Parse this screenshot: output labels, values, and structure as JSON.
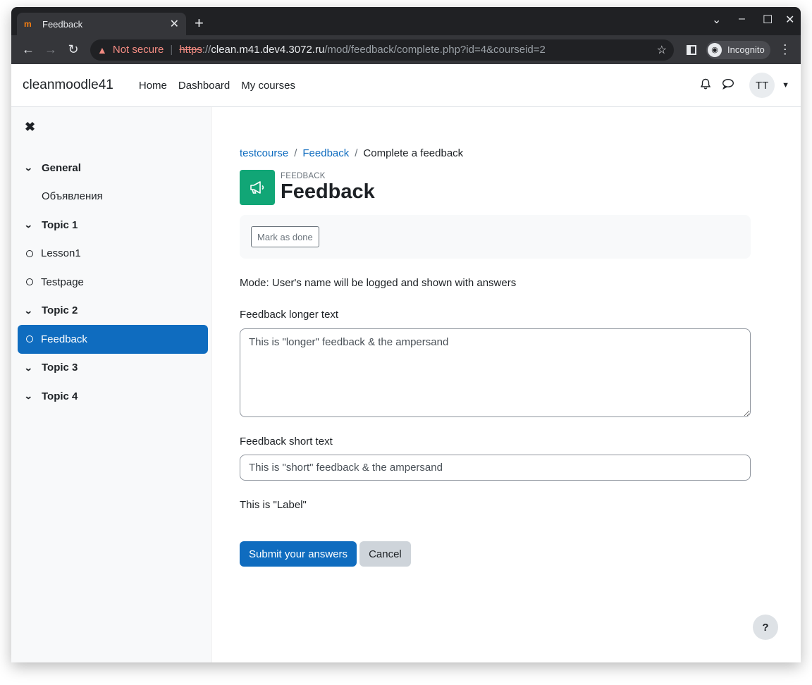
{
  "browser": {
    "tab_title": "Feedback",
    "favicon_text": "m",
    "url_warning": "Not secure",
    "url_protocol": "https",
    "url_sep": "://",
    "url_host": "clean.m41.dev4.3072.ru",
    "url_path": "/mod/feedback/complete.php?id=4&courseid=2",
    "incognito_label": "Incognito"
  },
  "navbar": {
    "brand": "cleanmoodle41",
    "links": [
      "Home",
      "Dashboard",
      "My courses"
    ],
    "avatar_initials": "TT"
  },
  "course_index": {
    "items": [
      {
        "label": "General",
        "kind": "section"
      },
      {
        "label": "Объявления",
        "kind": "plain"
      },
      {
        "label": "Topic 1",
        "kind": "section"
      },
      {
        "label": "Lesson1",
        "kind": "activity"
      },
      {
        "label": "Testpage",
        "kind": "activity"
      },
      {
        "label": "Topic 2",
        "kind": "section"
      },
      {
        "label": "Feedback",
        "kind": "activity",
        "active": true
      },
      {
        "label": "Topic 3",
        "kind": "section"
      },
      {
        "label": "Topic 4",
        "kind": "section"
      }
    ]
  },
  "breadcrumb": {
    "items": [
      "testcourse",
      "Feedback",
      "Complete a feedback"
    ],
    "separator": "/"
  },
  "header": {
    "pretitle": "FEEDBACK",
    "title": "Feedback"
  },
  "completion": {
    "mark_done_label": "Mark as done"
  },
  "form": {
    "mode_text": "Mode: User's name will be logged and shown with answers",
    "longer_label": "Feedback longer text",
    "longer_value": "This is \"longer\" feedback & the ampersand",
    "short_label": "Feedback short text",
    "short_value": "This is \"short\" feedback & the ampersand",
    "label_text": "This is \"Label\"",
    "submit_label": "Submit your answers",
    "cancel_label": "Cancel"
  },
  "help": {
    "label": "?"
  },
  "colors": {
    "primary": "#0f6cbf",
    "module_icon_bg": "#11a676",
    "drawer_bg": "#f8f9fa"
  }
}
